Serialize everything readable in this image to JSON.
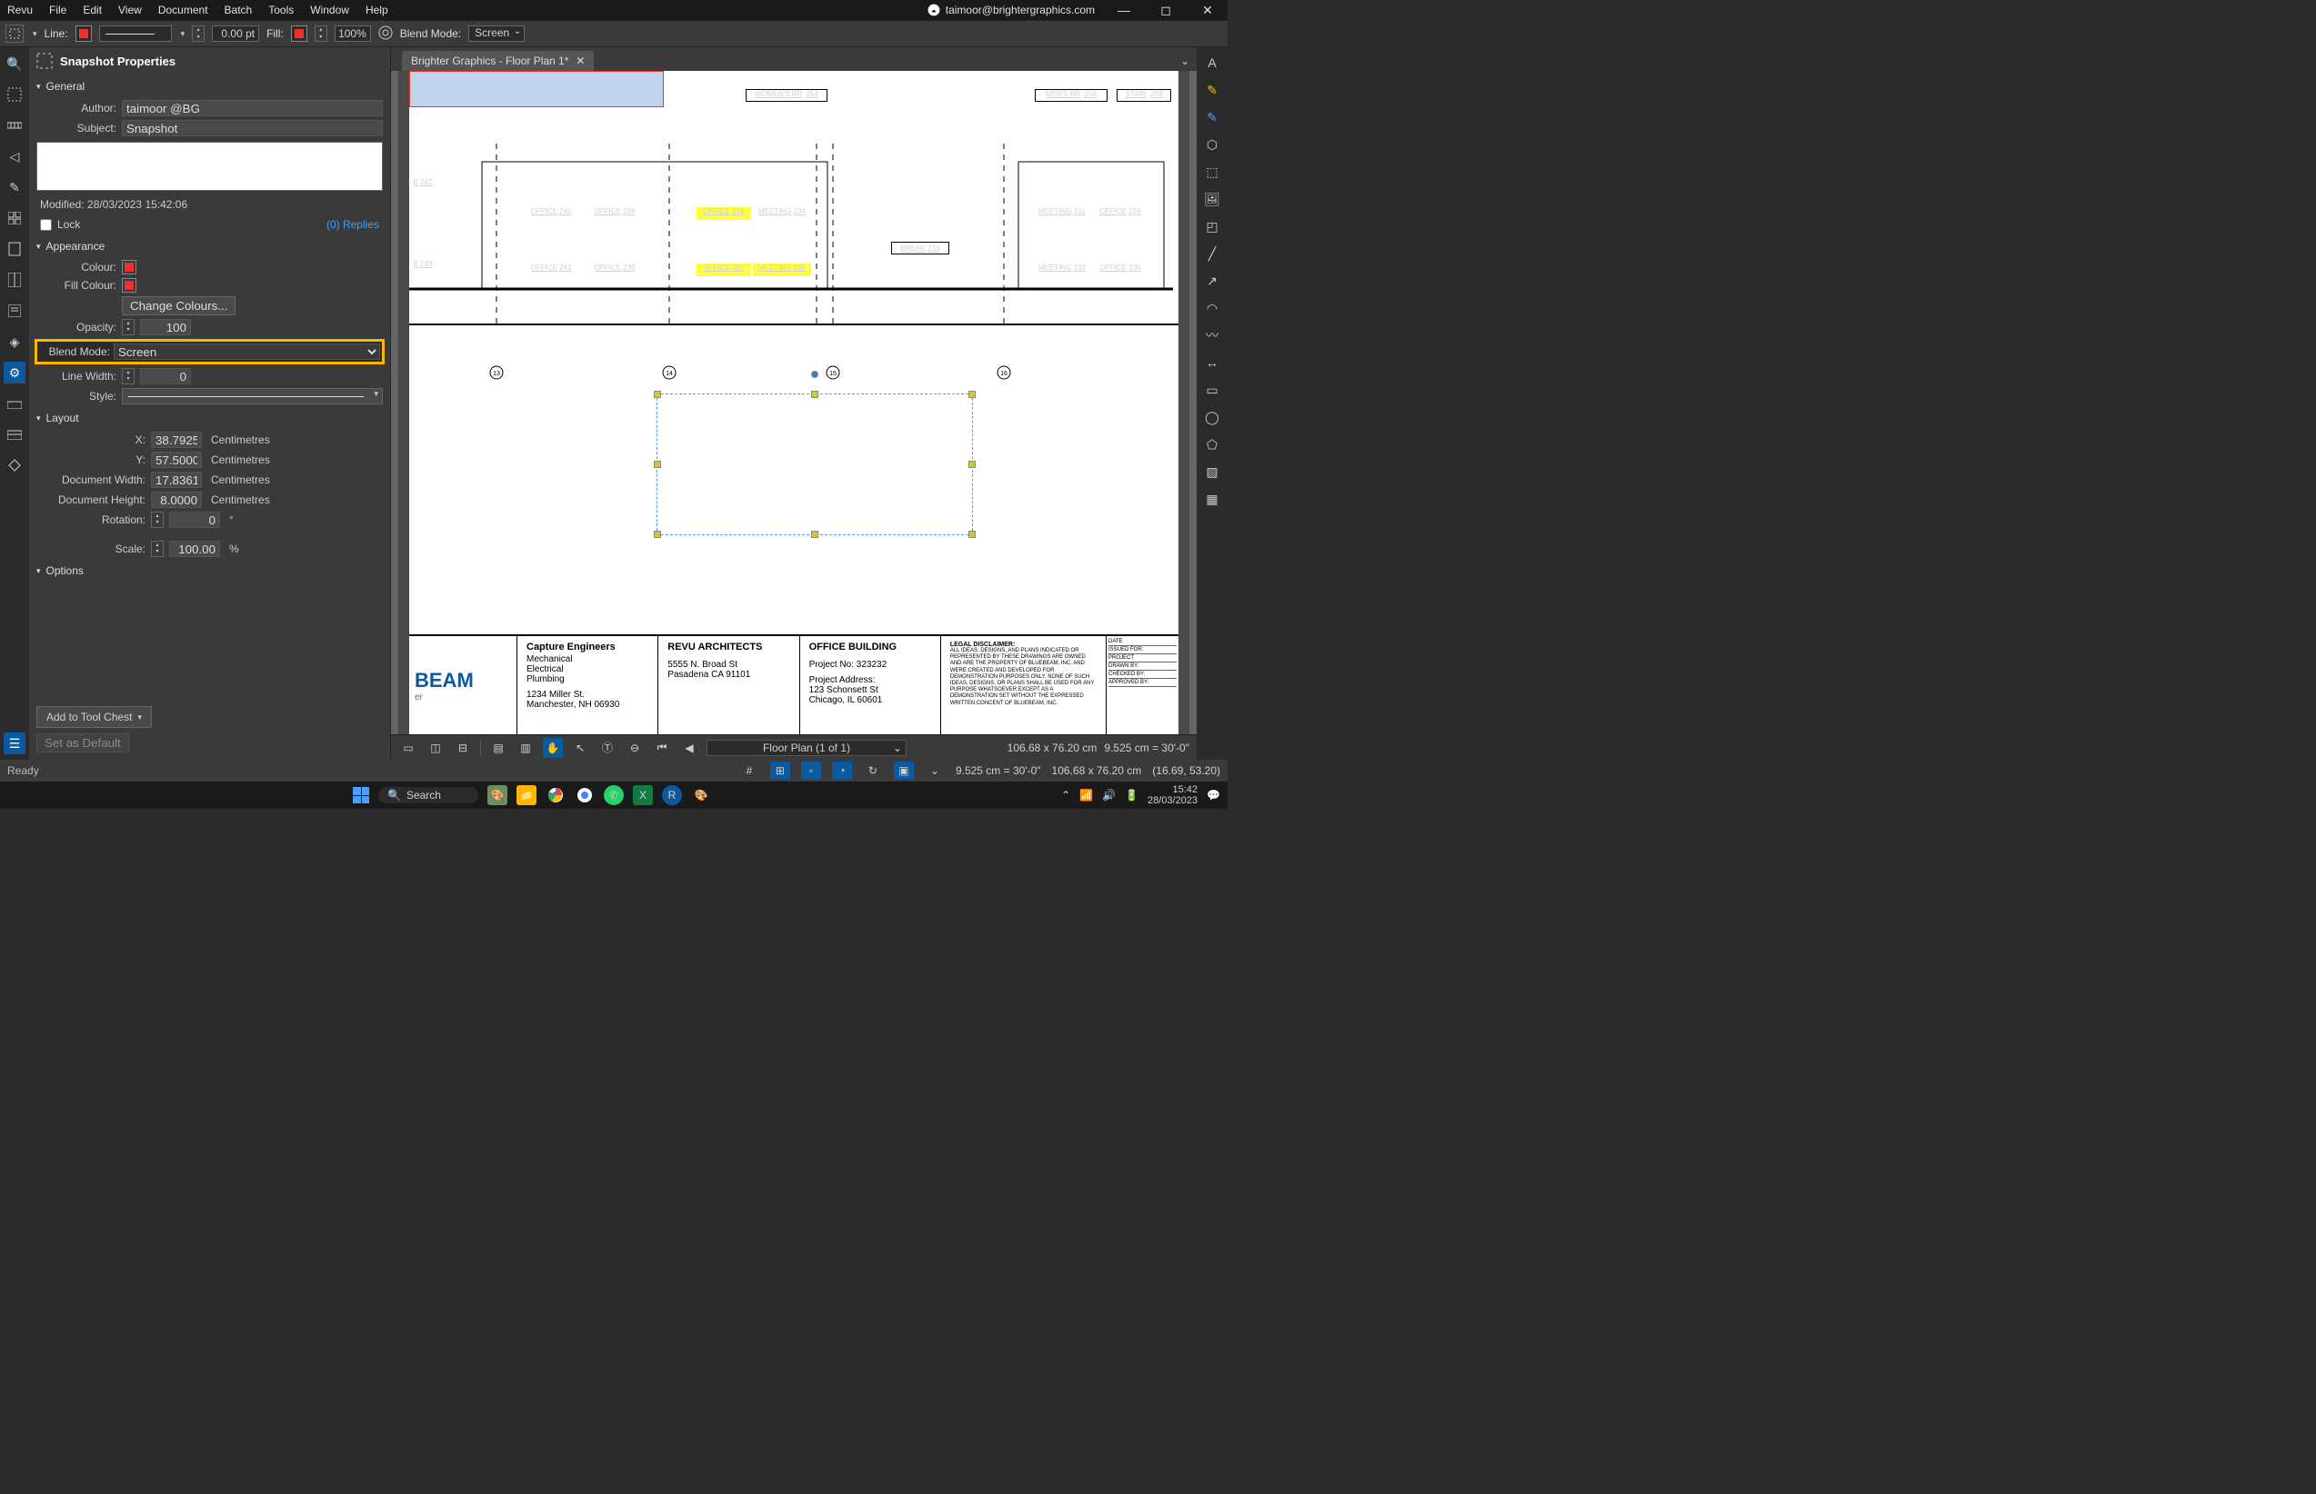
{
  "menubar": {
    "items": [
      "Revu",
      "File",
      "Edit",
      "View",
      "Document",
      "Batch",
      "Tools",
      "Window",
      "Help"
    ],
    "user": "taimoor@brightergraphics.com"
  },
  "toolbar": {
    "line_label": "Line:",
    "line_width_value": "0.00 pt",
    "fill_label": "Fill:",
    "fill_opacity": "100%",
    "blend_label": "Blend Mode:",
    "blend_value": "Screen"
  },
  "tab": {
    "title": "Brighter Graphics - Floor Plan 1*"
  },
  "panel": {
    "title": "Snapshot Properties",
    "general": {
      "header": "General",
      "author_label": "Author:",
      "author": "taimoor @BG",
      "subject_label": "Subject:",
      "subject": "Snapshot",
      "modified_label": "Modified:",
      "modified": "28/03/2023 15:42:06",
      "lock_label": "Lock",
      "replies": "(0) Replies"
    },
    "appearance": {
      "header": "Appearance",
      "colour_label": "Colour:",
      "fill_colour_label": "Fill Colour:",
      "change_colours": "Change Colours...",
      "opacity_label": "Opacity:",
      "opacity": "100",
      "blend_label": "Blend Mode:",
      "blend_value": "Screen",
      "line_width_label": "Line Width:",
      "line_width": "0",
      "style_label": "Style:"
    },
    "layout": {
      "header": "Layout",
      "x_label": "X:",
      "x": "38.7925",
      "y_label": "Y:",
      "y": "57.5000",
      "dw_label": "Document Width:",
      "dw": "17.8361",
      "dh_label": "Document Height:",
      "dh": "8.0000",
      "unit": "Centimetres",
      "rot_label": "Rotation:",
      "rot": "0",
      "rot_unit": "°",
      "scale_label": "Scale:",
      "scale": "100.00",
      "scale_unit": "%"
    },
    "options": {
      "header": "Options",
      "add_to_chest": "Add to Tool Chest",
      "set_default": "Set as Default"
    }
  },
  "floor": {
    "rooms_top": [
      {
        "label": "WOMEN'S RR",
        "num": "254"
      },
      {
        "label": "MEN'S RR",
        "num": "258"
      },
      {
        "label": "STAIR",
        "num": "259"
      }
    ],
    "rooms_mid": [
      {
        "label": "E",
        "num": "242"
      },
      {
        "label": "OFFICE",
        "num": "240"
      },
      {
        "label": "OFFICE",
        "num": "238"
      },
      {
        "label": "OFFICE",
        "num": "236",
        "hl": true
      },
      {
        "label": "MEETING",
        "num": "234"
      },
      {
        "label": "MEETING",
        "num": "231"
      },
      {
        "label": "OFFICE",
        "num": "229"
      }
    ],
    "rooms_low": [
      {
        "label": "E",
        "num": "243"
      },
      {
        "label": "OFFICE",
        "num": "241"
      },
      {
        "label": "OFFICE",
        "num": "239"
      },
      {
        "label": "OFFICE",
        "num": "237",
        "hl": true
      },
      {
        "label": "MEETING",
        "num": "235",
        "hl": true
      },
      {
        "label": "BREAK",
        "num": "233"
      },
      {
        "label": "MEETING",
        "num": "232"
      },
      {
        "label": "OFFICE",
        "num": "230"
      }
    ]
  },
  "titleblock": {
    "logo": "BEAM",
    "logo_sub": "er",
    "col1_h": "Capture Engineers",
    "col1_lines": [
      "Mechanical",
      "Electrical",
      "Plumbing",
      "",
      "1234 Miller St.",
      "Manchester, NH 06930"
    ],
    "col2_h": "REVU ARCHITECTS",
    "col2_lines": [
      "5555 N. Broad St",
      "Pasadena CA 91101"
    ],
    "col3_h": "OFFICE BUILDING",
    "col3_lines": [
      "Project No: 323232",
      "",
      "Project Address:",
      "123 Schonsett St",
      "Chicago, IL 60601"
    ],
    "legal_h": "LEGAL DISCLAIMER:",
    "legal": "ALL IDEAS, DESIGNS, AND PLANS INDICATED OR REPRESENTED BY THESE DRAWINGS ARE OWNED AND ARE THE PROPERTY OF BLUEBEAM, INC. AND WERE CREATED AND DEVELOPED FOR DEMONSTRATION PURPOSES ONLY. NONE OF SUCH IDEAS, DESIGNS, OR PLANS SHALL BE USED FOR ANY PURPOSE WHATSOEVER EXCEPT AS A DEMONSTRATION SET WITHOUT THE EXPRESSED WRITTEN CONCENT OF BLUEBEAM, INC.",
    "stamp": [
      "DATE",
      "ISSUED FOR:",
      "PROJECT",
      "DRAWN BY:",
      "CHECKED BY:",
      "APPROVED BY:"
    ]
  },
  "doc_status": {
    "page_label": "Floor Plan (1 of 1)",
    "dims": "106.68 x 76.20 cm",
    "scale": "9.525 cm = 30'-0\""
  },
  "statusbar": {
    "ready": "Ready",
    "scale": "9.525 cm = 30'-0\"",
    "dims": "106.68 x 76.20 cm",
    "coords": "(16.69, 53.20)"
  },
  "taskbar": {
    "search": "Search",
    "time": "15:42",
    "date": "28/03/2023"
  }
}
